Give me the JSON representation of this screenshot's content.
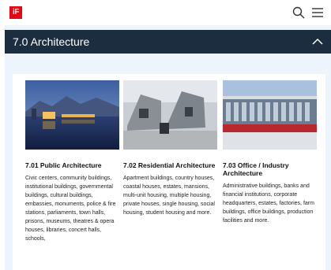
{
  "brand": {
    "logo_text": "iF",
    "accent": "#e30613"
  },
  "header": {
    "search_icon": "search-icon",
    "menu_icon": "hamburger-menu-icon"
  },
  "section": {
    "title": "7.0 Architecture",
    "expanded": true,
    "header_color": "#1c2d40"
  },
  "cards": [
    {
      "title": "7.01 Public Architecture",
      "description": "Civic centers, community buildings, institutional buildings, governmental buildings, cultural buildings, embassies, monuments, police & fire stations, parliaments, town halls, prisons, museums, theatres & opera houses, libraries, concert halls, schools,"
    },
    {
      "title": "7.02 Residential Architecture",
      "description": "Apartment buildings, country houses, coastal houses, estates, mansions, multi-unit housing, multiple housing, private houses, single housing, social housing, student housing and more."
    },
    {
      "title": "7.03 Office / Industry Architecture",
      "description": "Administrative buildings, banks and financial institutions, corporate headquarters, estates, factories, farm buildings, office buildings, production facilities and more."
    }
  ]
}
